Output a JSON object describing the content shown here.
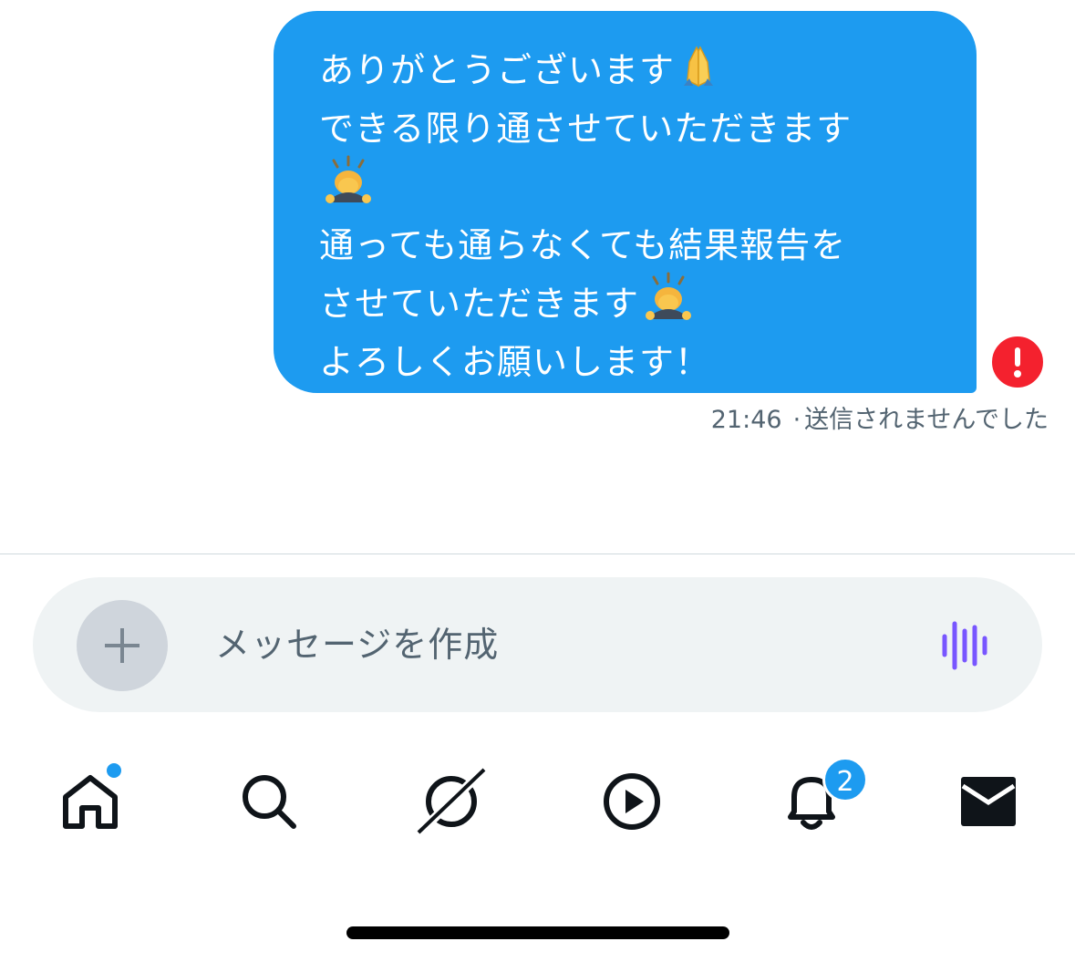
{
  "message": {
    "lines": [
      "ありがとうございます",
      "できる限り通させていただきます",
      "",
      "通っても通らなくても結果報告を",
      "させていただきます",
      "よろしくお願いします！"
    ],
    "time": "21:46",
    "status": "送信されませんでした",
    "separator": "·",
    "bubble_color": "#1d9bf0",
    "error_icon": "exclamation-circle-icon",
    "error_color": "#f4212e"
  },
  "composer": {
    "placeholder": "メッセージを作成",
    "add_icon": "plus-icon",
    "voice_icon": "voice-waveform-icon",
    "voice_color": "#7856ff"
  },
  "nav": {
    "items": [
      "home-icon",
      "search-icon",
      "grok-icon",
      "video-icon",
      "bell-icon",
      "mail-icon"
    ],
    "notifications_badge": "2"
  }
}
